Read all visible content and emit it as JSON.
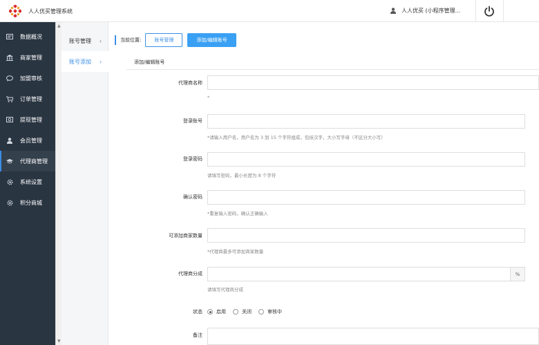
{
  "header": {
    "app_title": "人人优买管理系统",
    "user_name": "人人优买 (小程序管理..."
  },
  "sidebar": {
    "items": [
      {
        "label": "数据概况",
        "icon": "dashboard-icon"
      },
      {
        "label": "商家管理",
        "icon": "bank-icon"
      },
      {
        "label": "加盟审核",
        "icon": "chat-bubble-icon"
      },
      {
        "label": "订单管理",
        "icon": "cart-icon"
      },
      {
        "label": "提现管理",
        "icon": "cash-icon"
      },
      {
        "label": "会员管理",
        "icon": "user-icon"
      },
      {
        "label": "代理商管理",
        "icon": "graduation-cap-icon",
        "active": true
      },
      {
        "label": "系统设置",
        "icon": "gear-icon"
      },
      {
        "label": "积分商城",
        "icon": "gear-icon"
      }
    ]
  },
  "submenu": {
    "items": [
      {
        "label": "账号管理"
      },
      {
        "label": "账号添加",
        "active": true
      }
    ]
  },
  "breadcrumb": {
    "label": "当前位置:",
    "items": [
      "账号管理",
      "添加/编辑账号"
    ]
  },
  "panel": {
    "title": "添加/编辑账号"
  },
  "form": {
    "agent_name": {
      "label": "代理商名称",
      "value": "",
      "hint": "*"
    },
    "login_account": {
      "label": "登录账号",
      "value": "",
      "hint": "*请输入用户名，用户名为 3 到 15 个字符组成，包括汉字，大小写字母（不区分大小写）"
    },
    "login_password": {
      "label": "登录密码",
      "value": "",
      "hint": "请填写密码，最小长度为 8 个字符"
    },
    "confirm_password": {
      "label": "确认密码",
      "value": "",
      "hint": "*重复输入密码，确认正确输入"
    },
    "merchant_quota": {
      "label": "可添加商家数量",
      "value": "",
      "hint": "*代理商最多可添加商家数量"
    },
    "commission": {
      "label": "代理商分成",
      "value": "",
      "addon": "%",
      "hint": "请填写代理商分成"
    },
    "status": {
      "label": "状态",
      "options": [
        "启用",
        "关闭",
        "审核中"
      ],
      "selected": "启用"
    },
    "remark": {
      "label": "备注",
      "value": ""
    }
  },
  "colors": {
    "sidebar_bg": "#2a3542",
    "accent": "#3a8ee6",
    "accent_solid": "#3aa0f3"
  }
}
